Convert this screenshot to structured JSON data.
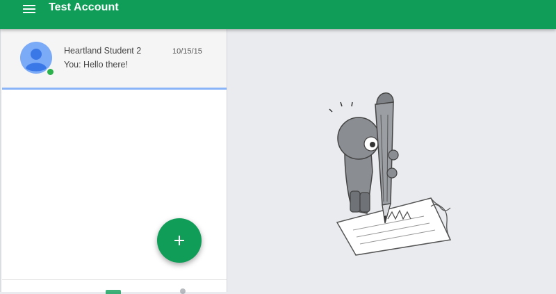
{
  "header": {
    "title": "Test Account",
    "menu_icon": "hamburger-menu-icon"
  },
  "conversations": [
    {
      "name": "Heartland Student 2",
      "preview": "You: Hello there!",
      "date": "10/15/15",
      "avatar_icon": "default-person-avatar",
      "online": true
    }
  ],
  "fab": {
    "icon": "plus-icon"
  },
  "empty_state": {
    "illustration": "character-with-pencil"
  },
  "colors": {
    "primary": "#0f9d58",
    "selected_border": "#8ab4f8",
    "online": "#2bb24c",
    "avatar": "#7baaf7",
    "main_bg": "#e9ebee"
  }
}
